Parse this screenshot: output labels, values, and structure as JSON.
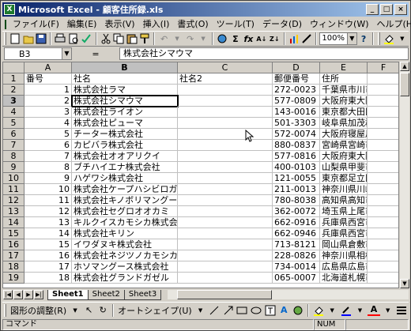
{
  "window": {
    "title": "Microsoft Excel - 顧客住所録.xls",
    "icon": "excel-app-icon",
    "minimize": "_",
    "maximize": "□",
    "close": "×"
  },
  "menu": [
    "ファイル(F)",
    "編集(E)",
    "表示(V)",
    "挿入(I)",
    "書式(O)",
    "ツール(T)",
    "データ(D)",
    "ウィンドウ(W)",
    "ヘルプ(H)"
  ],
  "toolbar": {
    "zoom": "100%"
  },
  "formula": {
    "cell": "B3",
    "eq": "=",
    "value": "株式会社シマウマ"
  },
  "columns": [
    "A",
    "B",
    "C",
    "D",
    "E",
    "F"
  ],
  "rows": [
    {
      "n": "1",
      "a": "番号",
      "b": "社名",
      "c": "社名2",
      "d": "郵便番号",
      "e": "住所"
    },
    {
      "n": "2",
      "a": "1",
      "b": "株式会社ラマ",
      "c": "",
      "d": "272-0023",
      "e": "千葉県市川市南八幡"
    },
    {
      "n": "3",
      "a": "2",
      "b": "株式会社シマウマ",
      "c": "",
      "d": "577-0809",
      "e": "大阪府東大阪市永和"
    },
    {
      "n": "4",
      "a": "3",
      "b": "株式会社ライオン",
      "c": "",
      "d": "143-0016",
      "e": "東京都大田区大森北"
    },
    {
      "n": "5",
      "a": "4",
      "b": "株式会社ピューマ",
      "c": "",
      "d": "501-3303",
      "e": "岐阜県加茂郡富加町"
    },
    {
      "n": "6",
      "a": "5",
      "b": "チーター株式会社",
      "c": "",
      "d": "572-0074",
      "e": "大阪府寝屋川市池田"
    },
    {
      "n": "7",
      "a": "6",
      "b": "カピバラ株式会社",
      "c": "",
      "d": "880-0837",
      "e": "宮崎県宮崎市村角町"
    },
    {
      "n": "8",
      "a": "7",
      "b": "株式会社オオアリクイ",
      "c": "",
      "d": "577-0816",
      "e": "大阪府東大阪市友井"
    },
    {
      "n": "9",
      "a": "8",
      "b": "ブチハイエナ株式会社",
      "c": "",
      "d": "400-0103",
      "e": "山梨県甲斐市大垈"
    },
    {
      "n": "10",
      "a": "9",
      "b": "ハゲワシ株式会社",
      "c": "",
      "d": "121-0055",
      "e": "東京都足立区加平"
    },
    {
      "n": "11",
      "a": "10",
      "b": "株式会社ケープハシビロガオオカモシカ",
      "c": "",
      "d": "211-0013",
      "e": "神奈川県川崎市中原"
    },
    {
      "n": "12",
      "a": "11",
      "b": "株式会社キノボリマングース",
      "c": "",
      "d": "780-8038",
      "e": "高知県高知市石立町"
    },
    {
      "n": "13",
      "a": "12",
      "b": "株式会社セグロオオカミ",
      "c": "",
      "d": "362-0072",
      "e": "埼玉県上尾市中妻"
    },
    {
      "n": "14",
      "a": "13",
      "b": "キルクイスカモシカ株式会社",
      "c": "",
      "d": "662-0916",
      "e": "兵庫県西宮市戸田町"
    },
    {
      "n": "15",
      "a": "14",
      "b": "株式会社キリン",
      "c": "",
      "d": "662-0946",
      "e": "兵庫県西宮市荒戎町"
    },
    {
      "n": "16",
      "a": "15",
      "b": "イワダヌキ株式会社",
      "c": "",
      "d": "713-8121",
      "e": "岡山県倉敷市玉島"
    },
    {
      "n": "17",
      "a": "16",
      "b": "株式会社ネジツノカモシカ",
      "c": "",
      "d": "228-0826",
      "e": "神奈川県相模原市新戸"
    },
    {
      "n": "18",
      "a": "17",
      "b": "ホソマングース株式会社",
      "c": "",
      "d": "734-0014",
      "e": "広島県広島市南区宇品"
    },
    {
      "n": "19",
      "a": "18",
      "b": "株式会社グランドガゼル",
      "c": "",
      "d": "065-0007",
      "e": "北海道札幌市東区北"
    }
  ],
  "sheets": [
    "Sheet1",
    "Sheet2",
    "Sheet3"
  ],
  "drawbar": {
    "adjust": "図形の調整(R)",
    "autoshape": "オートシェイプ(U)"
  },
  "status": {
    "mode": "コマンド",
    "num": "NUM"
  }
}
